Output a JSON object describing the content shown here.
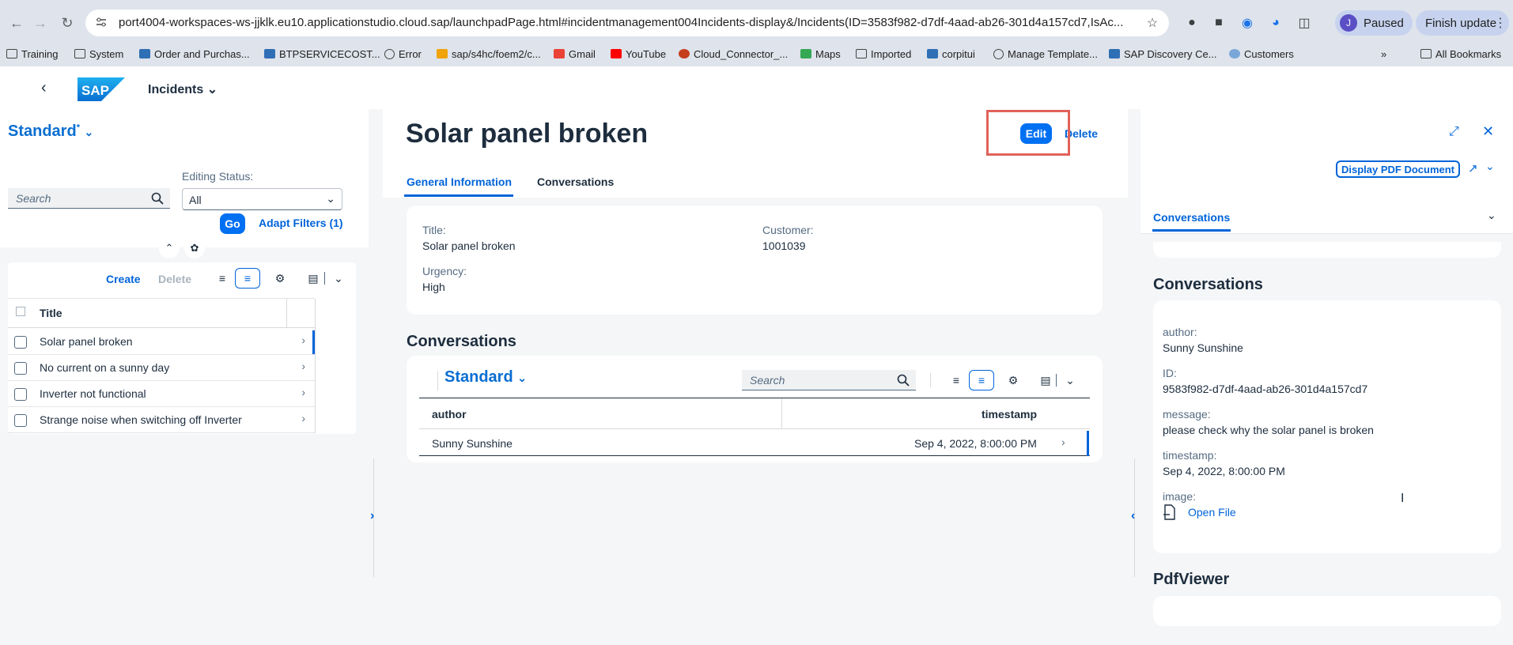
{
  "browser": {
    "url": "port4004-workspaces-ws-jjklk.eu10.applicationstudio.cloud.sap/launchpadPage.html#incidentmanagement004Incidents-display&/Incidents(ID=3583f982-d7df-4aad-ab26-301d4a157cd7,IsAc...",
    "profile_initial": "J",
    "profile_status": "Paused",
    "update_label": "Finish update",
    "bookmarks": [
      {
        "label": "Training",
        "icon": "folder-icon"
      },
      {
        "label": "System",
        "icon": "folder-icon"
      },
      {
        "label": "Order and Purchas...",
        "icon": "site-icon"
      },
      {
        "label": "BTPSERVICECOST...",
        "icon": "site-icon"
      },
      {
        "label": "Error",
        "icon": "globe-icon"
      },
      {
        "label": "sap/s4hc/foem2/c...",
        "icon": "site-icon"
      },
      {
        "label": "Gmail",
        "icon": "gmail-icon"
      },
      {
        "label": "YouTube",
        "icon": "youtube-icon"
      },
      {
        "label": "Cloud_Connector_...",
        "icon": "ppt-icon"
      },
      {
        "label": "Maps",
        "icon": "maps-icon"
      },
      {
        "label": "Imported",
        "icon": "folder-icon"
      },
      {
        "label": "corpitui",
        "icon": "site-icon"
      },
      {
        "label": "Manage Template...",
        "icon": "globe-icon"
      },
      {
        "label": "SAP Discovery Ce...",
        "icon": "site-icon"
      },
      {
        "label": "Customers",
        "icon": "cloud-icon"
      }
    ],
    "all_bookmarks": "All Bookmarks"
  },
  "shell": {
    "logo": "SAP",
    "title": "Incidents"
  },
  "list": {
    "variant": "Standard",
    "variant_marker": "*",
    "search_placeholder": "Search",
    "editing_status_label": "Editing Status:",
    "editing_status_value": "All",
    "go_label": "Go",
    "adapt_filters_label": "Adapt Filters (1)",
    "create_label": "Create",
    "delete_label": "Delete",
    "column_title": "Title",
    "rows": [
      "Solar panel broken",
      "No current on a sunny day",
      "Inverter not functional",
      "Strange noise when switching off Inverter"
    ]
  },
  "object": {
    "title": "Solar panel broken",
    "edit_label": "Edit",
    "delete_label": "Delete",
    "tabs": [
      "General Information",
      "Conversations"
    ],
    "fields": {
      "title_label": "Title:",
      "title_value": "Solar panel broken",
      "customer_label": "Customer:",
      "customer_value": "1001039",
      "urgency_label": "Urgency:",
      "urgency_value": "High"
    },
    "conversations_title": "Conversations",
    "conv_variant": "Standard",
    "conv_search_placeholder": "Search",
    "conv_columns": [
      "author",
      "timestamp"
    ],
    "conv_rows": [
      {
        "author": "Sunny Sunshine",
        "timestamp": "Sep 4, 2022, 8:00:00 PM"
      }
    ]
  },
  "detail": {
    "pdf_button": "Display PDF Document",
    "tab": "Conversations",
    "section_title": "Conversations",
    "author_label": "author:",
    "author_value": "Sunny Sunshine",
    "id_label": "ID:",
    "id_value": "9583f982-d7df-4aad-ab26-301d4a157cd7",
    "message_label": "message:",
    "message_value": "please check why the solar panel is broken",
    "timestamp_label": "timestamp:",
    "timestamp_value": "Sep 4, 2022, 8:00:00 PM",
    "image_label": "image:",
    "open_file": "Open File",
    "pdf_viewer_title": "PdfViewer"
  },
  "colors": {
    "accent": "#0070f2",
    "link": "#0064d9",
    "highlight_box": "#e0625a",
    "shell_bg": "#ffffff",
    "page_bg": "#f5f6f7"
  }
}
